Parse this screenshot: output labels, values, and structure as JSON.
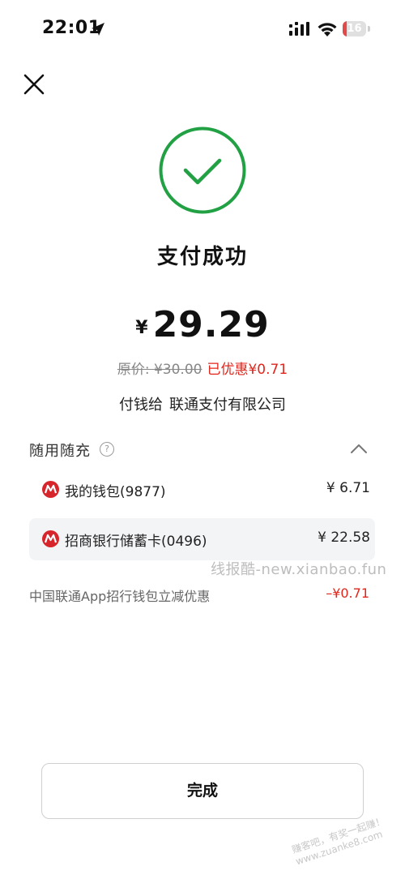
{
  "status_bar": {
    "time": "22:01",
    "battery": "16",
    "battery_level": 0.16
  },
  "result": {
    "title": "支付成功",
    "currency": "¥",
    "amount": "29.29"
  },
  "discount": {
    "original": "原价: ¥30.00",
    "saved": "已优惠¥0.71"
  },
  "payee": {
    "prefix": "付钱给",
    "name": "联通支付有限公司"
  },
  "payment_section": {
    "label": "随用随充",
    "help": "?",
    "methods": [
      {
        "label": "我的钱包(9877)",
        "amount": "¥ 6.71",
        "selected": false
      },
      {
        "label": "招商银行储蓄卡(0496)",
        "amount": "¥ 22.58",
        "selected": true
      }
    ]
  },
  "promo": {
    "label": "中国联通App招行钱包立减优惠",
    "amount": "–¥0.71"
  },
  "watermark": "线报酷-new.xianbao.fun",
  "watermark_corner": "赚客吧，有奖一起赚！www.zuanke8.com",
  "done_button": {
    "label": "完成"
  },
  "colors": {
    "success_green": "#21a144",
    "discount_red": "#e1251b",
    "bank_red": "#d7262b",
    "battery_red": "#e24a4a"
  },
  "icons": [
    "location-arrow-icon",
    "signal-icon",
    "wifi-icon",
    "battery-icon",
    "close-icon",
    "success-check-icon",
    "help-icon",
    "chevron-up-icon",
    "cmb-logo-icon"
  ]
}
